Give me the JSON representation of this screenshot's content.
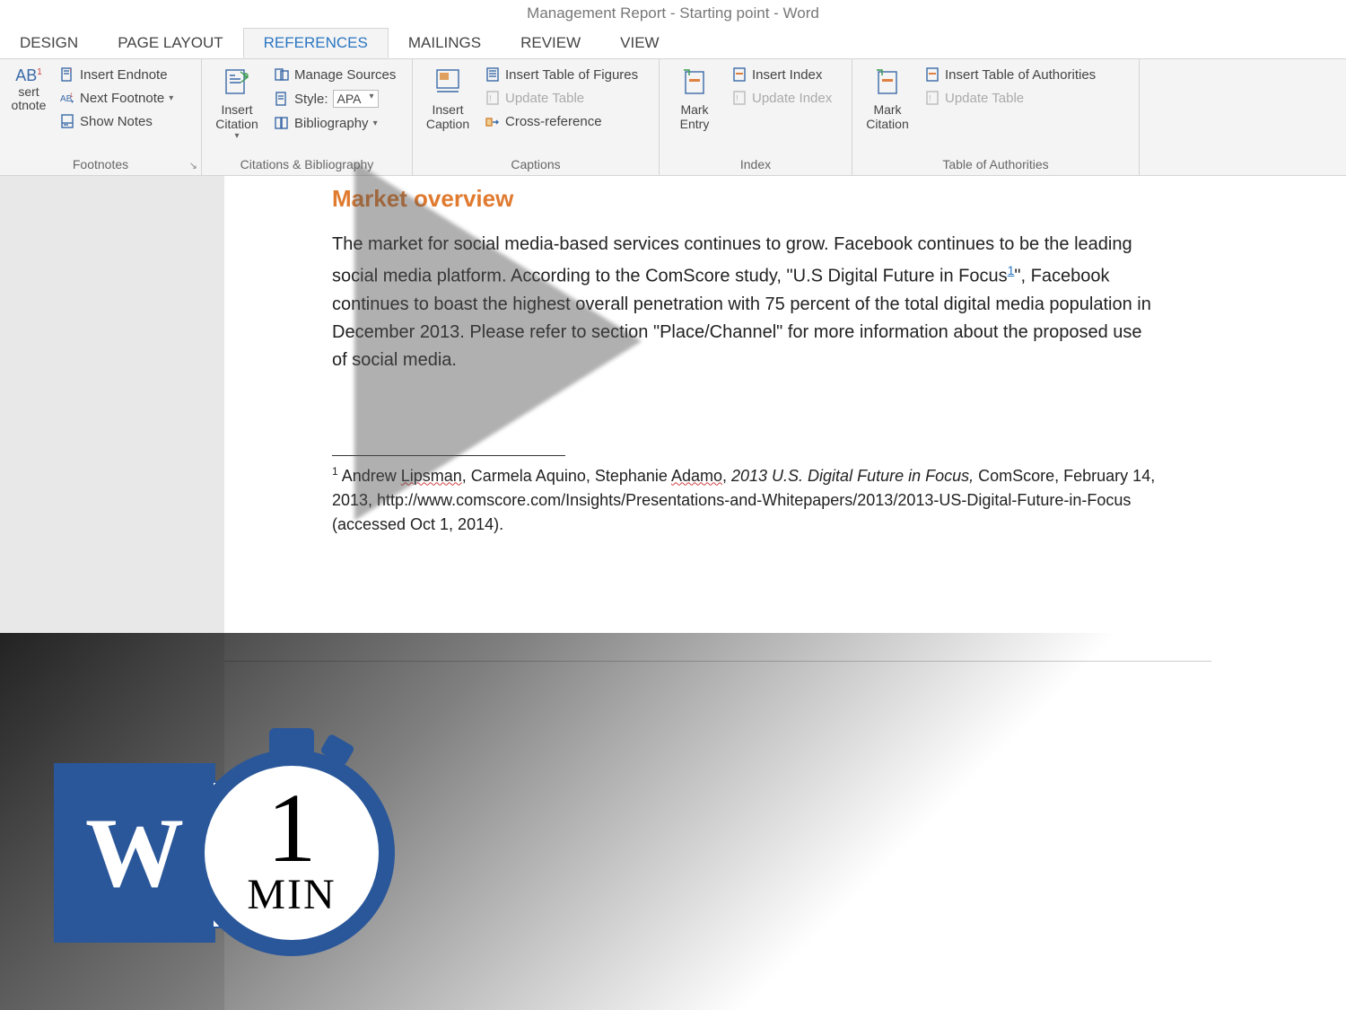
{
  "titlebar": "Management Report - Starting point - Word",
  "tabs": {
    "design": "DESIGN",
    "page_layout": "PAGE LAYOUT",
    "references": "REFERENCES",
    "mailings": "MAILINGS",
    "review": "REVIEW",
    "view": "VIEW"
  },
  "ribbon": {
    "footnotes": {
      "insert_footnote_big": "sert otnote",
      "ab_label": "AB",
      "insert_endnote": "Insert Endnote",
      "next_footnote": "Next Footnote",
      "show_notes": "Show Notes",
      "group_label": "Footnotes"
    },
    "citations": {
      "insert_citation": "Insert Citation",
      "manage_sources": "Manage Sources",
      "style_label": "Style:",
      "style_value": "APA",
      "bibliography": "Bibliography",
      "group_label": "Citations & Bibliography"
    },
    "captions": {
      "insert_caption": "Insert Caption",
      "insert_table_figures": "Insert Table of Figures",
      "update_table": "Update Table",
      "cross_reference": "Cross-reference",
      "group_label": "Captions"
    },
    "index": {
      "mark_entry": "Mark Entry",
      "insert_index": "Insert Index",
      "update_index": "Update Index",
      "group_label": "Index"
    },
    "authorities": {
      "mark_citation": "Mark Citation",
      "insert_table_auth": "Insert Table of Authorities",
      "update_table": "Update Table",
      "group_label": "Table of Authorities"
    }
  },
  "document": {
    "heading": "Market overview",
    "body_p1_a": "The market for social media-based services continues to grow. Facebook continues to be the leading social media platform.  According to the ComScore study, \"U.S Digital Future in Focus",
    "body_p1_sup": "1",
    "body_p1_b": "\", Facebook continues to boast the highest overall penetration with 75 percent of the total digital media population in December 2013. Please refer to section \"Place/Channel\" for more information about the proposed use of social media.",
    "fn_num": "1",
    "fn_a": " Andrew ",
    "fn_name1": "Lipsman",
    "fn_b": ", Carmela Aquino, Stephanie ",
    "fn_name2": "Adamo",
    "fn_c": ", ",
    "fn_title": "2013 U.S. Digital Future in Focus,",
    "fn_d": " ComScore, February 14, 2013, http://www.comscore.com/Insights/Presentations-and-Whitepapers/2013/2013-US-Digital-Future-in-Focus (accessed Oct 1, 2014)."
  },
  "badge": {
    "logo": "W",
    "time_num": "1",
    "time_unit": "MIN"
  }
}
